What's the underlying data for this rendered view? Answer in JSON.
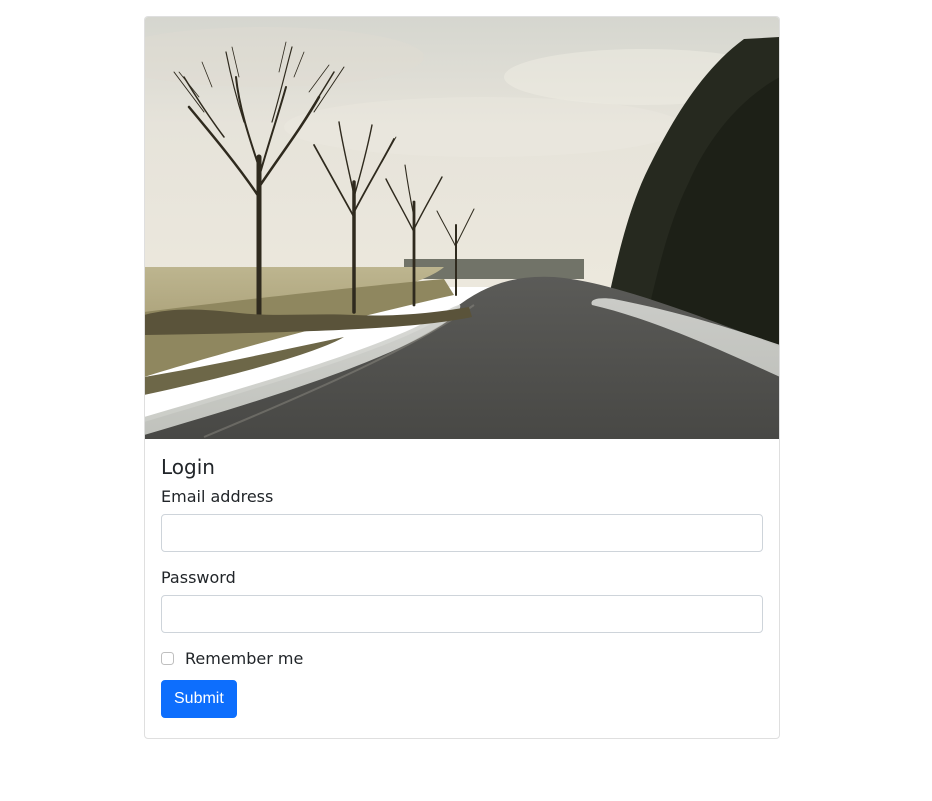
{
  "hero": {
    "alt": "road-with-trees-image"
  },
  "form": {
    "title": "Login",
    "email_label": "Email address",
    "password_label": "Password",
    "remember_label": "Remember me",
    "submit_label": "Submit"
  },
  "colors": {
    "primary": "#0d6efd",
    "border": "#ced4da",
    "card_border": "rgba(0,0,0,0.125)"
  }
}
